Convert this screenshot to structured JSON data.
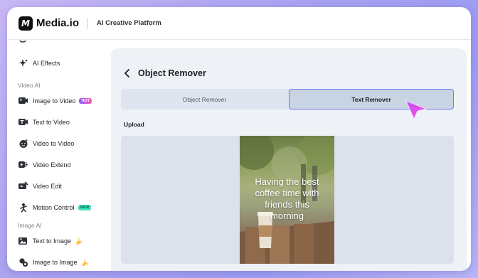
{
  "header": {
    "logo_letter": "M",
    "brand": "Media.io",
    "platform": "AI Creative Platform"
  },
  "sidebar": {
    "items": [
      {
        "label": "AI Effects",
        "icon": "sparkle-icon"
      },
      {
        "label": "Image to Video",
        "icon": "image-video-icon",
        "badge": "HOT"
      },
      {
        "label": "Text to Video",
        "icon": "text-video-icon"
      },
      {
        "label": "Video to Video",
        "icon": "face-video-icon"
      },
      {
        "label": "Video Extend",
        "icon": "video-extend-icon"
      },
      {
        "label": "Video Edit",
        "icon": "video-edit-icon"
      },
      {
        "label": "Motion Control",
        "icon": "motion-control-icon",
        "badge": "NEW"
      },
      {
        "label": "Text to Image",
        "icon": "text-image-icon",
        "badge": "🍌"
      },
      {
        "label": "Image to Image",
        "icon": "image-image-icon",
        "badge": "🍌"
      }
    ],
    "sections": {
      "video_ai": "Video AI",
      "image_ai": "Image AI"
    }
  },
  "main": {
    "title": "Object Remover",
    "tabs": [
      {
        "label": "Object Remover",
        "selected": false
      },
      {
        "label": "Text Remover",
        "selected": true
      }
    ],
    "upload_label": "Upload",
    "photo_text_lines": [
      "Having the best",
      "coffee time with",
      "friends this",
      "morning"
    ]
  },
  "colors": {
    "accent": "#6f78f5",
    "selected_tab_bg": "#c9d4e2",
    "panel_bg": "#eef1f6",
    "cursor_gradient": [
      "#c04dff",
      "#ff4fd0"
    ]
  }
}
